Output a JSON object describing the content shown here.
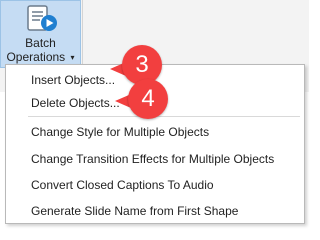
{
  "ribbon": {
    "batch_button": {
      "label_line1": "Batch",
      "label_line2": "Operations",
      "caret": "▾"
    }
  },
  "menu": {
    "items": [
      {
        "label": "Insert Objects..."
      },
      {
        "label": "Delete Objects..."
      },
      {
        "label": "Change Style for Multiple Objects"
      },
      {
        "label": "Change Transition Effects for Multiple Objects"
      },
      {
        "label": "Convert Closed Captions To Audio"
      },
      {
        "label": "Generate Slide Name from First Shape"
      }
    ]
  },
  "annotations": {
    "badge_3": "3",
    "badge_4": "4",
    "badge_color": "#f23f3f"
  },
  "icons": {
    "batch": "batch-operations-icon"
  }
}
